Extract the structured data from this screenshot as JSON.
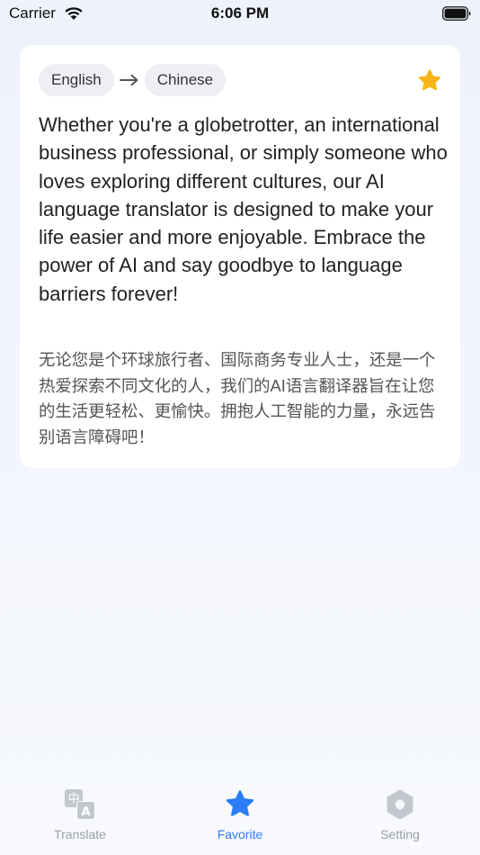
{
  "status_bar": {
    "carrier": "Carrier",
    "time": "6:06 PM",
    "wifi_icon": "wifi-icon",
    "battery_icon": "battery-full-icon"
  },
  "card": {
    "source_language": "English",
    "target_language": "Chinese",
    "favorite_icon": "star-filled-icon",
    "favorite_color": "#f6b417",
    "source_text": "Whether you're a globetrotter, an international business professional, or simply someone who loves exploring different cultures, our AI language translator is designed to make your life easier and more enjoyable. Embrace the power of AI and say goodbye to language barriers forever!",
    "translated_text": "无论您是个环球旅行者、国际商务专业人士，还是一个热爱探索不同文化的人，我们的AI语言翻译器旨在让您的生活更轻松、更愉快。拥抱人工智能的力量，永远告别语言障碍吧！"
  },
  "tab_bar": {
    "active_color": "#2b7cf6",
    "inactive_color": "#9a9ea6",
    "tabs": [
      {
        "label": "Translate",
        "icon": "translate-icon",
        "active": false
      },
      {
        "label": "Favorite",
        "icon": "star-icon",
        "active": true
      },
      {
        "label": "Setting",
        "icon": "gear-icon",
        "active": false
      }
    ]
  }
}
